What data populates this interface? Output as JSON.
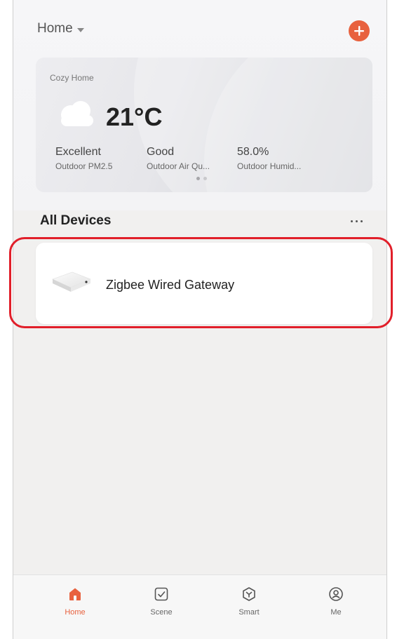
{
  "header": {
    "home_label": "Home"
  },
  "weather": {
    "card_name": "Cozy Home",
    "temperature": "21°C",
    "stats": [
      {
        "value": "Excellent",
        "label": "Outdoor PM2.5"
      },
      {
        "value": "Good",
        "label": "Outdoor Air Qu..."
      },
      {
        "value": "58.0%",
        "label": "Outdoor Humid..."
      }
    ],
    "page_count": 2,
    "active_page": 1
  },
  "devices": {
    "title": "All Devices",
    "items": [
      {
        "name": "Zigbee Wired Gateway"
      }
    ]
  },
  "tabs": [
    {
      "label": "Home",
      "icon": "home-icon",
      "active": true
    },
    {
      "label": "Scene",
      "icon": "checkbox-icon",
      "active": false
    },
    {
      "label": "Smart",
      "icon": "smart-icon",
      "active": false
    },
    {
      "label": "Me",
      "icon": "profile-icon",
      "active": false
    }
  ],
  "colors": {
    "accent": "#e8613e",
    "highlight": "#e11f2a"
  }
}
